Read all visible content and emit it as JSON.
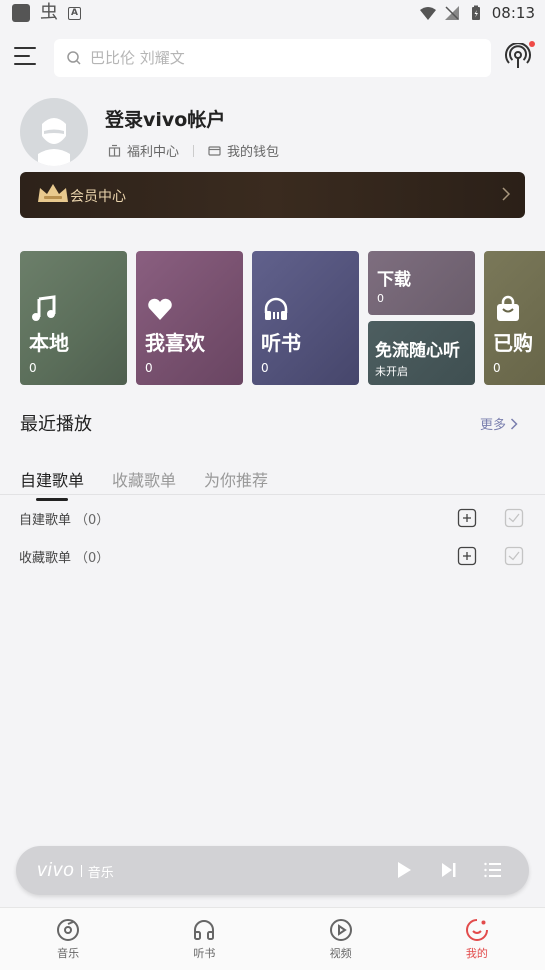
{
  "status_bar": {
    "time": "08:13"
  },
  "search": {
    "placeholder": "巴比伦 刘耀文"
  },
  "profile": {
    "login_label": "登录vivo帐户",
    "welfare_label": "福利中心",
    "wallet_label": "我的钱包"
  },
  "vip": {
    "label": "会员中心"
  },
  "tiles": {
    "local": {
      "label": "本地",
      "count": "0"
    },
    "favorites": {
      "label": "我喜欢",
      "count": "0"
    },
    "audiobooks": {
      "label": "听书",
      "count": "0"
    },
    "downloads": {
      "label": "下载",
      "count": "0"
    },
    "free_flow": {
      "label": "免流随心听",
      "status": "未开启"
    },
    "purchased": {
      "label": "已购",
      "count": "0"
    }
  },
  "recent": {
    "title": "最近播放",
    "more_label": "更多"
  },
  "playlist_tabs": [
    "自建歌单",
    "收藏歌单",
    "为你推荐"
  ],
  "playlists": [
    {
      "label": "自建歌单",
      "count": "（0）"
    },
    {
      "label": "收藏歌单",
      "count": "（0）"
    }
  ],
  "player": {
    "brand": "vivo",
    "brand_sub": "音乐"
  },
  "bottom_nav": [
    {
      "label": "音乐",
      "icon": "music-disc-icon"
    },
    {
      "label": "听书",
      "icon": "headphones-icon"
    },
    {
      "label": "视频",
      "icon": "play-circle-icon"
    },
    {
      "label": "我的",
      "icon": "smile-icon"
    }
  ],
  "colors": {
    "accent_red": "#e24b4b",
    "more_link": "#7a7fae",
    "vip_text": "#e9d3ac"
  }
}
